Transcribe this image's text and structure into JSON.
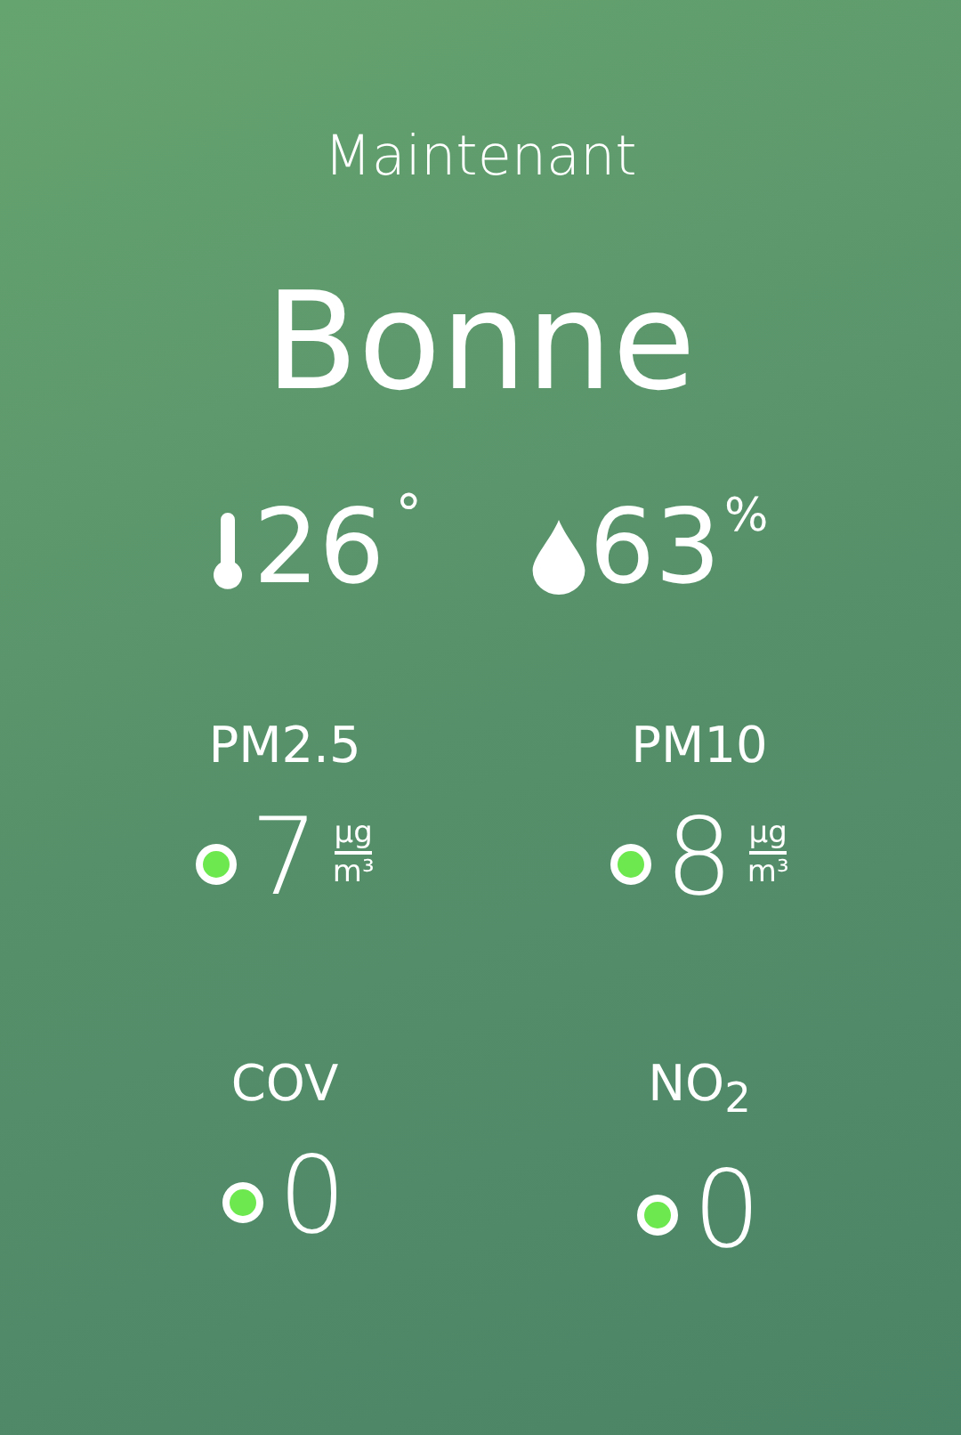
{
  "period": "Maintenant",
  "quality": "Bonne",
  "temperature": {
    "value": "26",
    "unit": "°"
  },
  "humidity": {
    "value": "63",
    "unit": "%"
  },
  "pollutants": [
    {
      "name": "PM2.5",
      "value": "7",
      "unit_top": "µg",
      "unit_bottom": "m³",
      "color": "#6ee84f"
    },
    {
      "name": "PM10",
      "value": "8",
      "unit_top": "µg",
      "unit_bottom": "m³",
      "color": "#6ee84f"
    },
    {
      "name": "COV",
      "value": "0",
      "color": "#6ee84f"
    },
    {
      "name": "NO$_{2}$",
      "value": "0",
      "color": "#6ee84f"
    }
  ]
}
